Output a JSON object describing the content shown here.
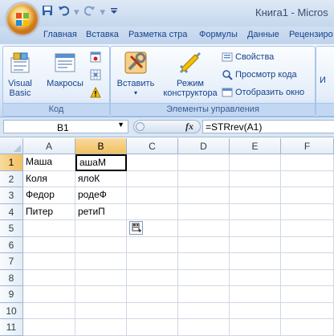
{
  "window": {
    "title": "Книга1 - Micros"
  },
  "quick_access": {
    "save_icon": "save-icon",
    "undo_icon": "undo-icon",
    "redo_icon": "redo-icon",
    "customize_icon": "chevron-down-icon"
  },
  "tabs": [
    {
      "label": "Главная"
    },
    {
      "label": "Вставка"
    },
    {
      "label": "Разметка стра"
    },
    {
      "label": "Формулы"
    },
    {
      "label": "Данные"
    },
    {
      "label": "Рецензиро"
    }
  ],
  "ribbon": {
    "code_group": {
      "label": "Код",
      "visual_basic": "Visual Basic",
      "visual_basic_line1": "Visual",
      "visual_basic_line2": "Basic",
      "macros": "Макросы"
    },
    "controls_group": {
      "label": "Элементы управления",
      "insert": "Вставить",
      "design_mode_line1": "Режим",
      "design_mode_line2": "конструктора",
      "properties": "Свойства",
      "view_code": "Просмотр кода",
      "show_window": "Отобразить окно"
    },
    "next_group": {
      "partial_label": "И"
    }
  },
  "formula_bar": {
    "name_box": "B1",
    "fx": "fx",
    "formula": "=STRrev(A1)"
  },
  "sheet": {
    "columns": [
      "A",
      "B",
      "C",
      "D",
      "E",
      "F"
    ],
    "rows": [
      "1",
      "2",
      "3",
      "4",
      "5",
      "6",
      "7",
      "8",
      "9",
      "10",
      "11"
    ],
    "selected_col": "B",
    "selected_row": "1",
    "cells": {
      "A1": "Маша",
      "B1": "ашаМ",
      "A2": "Коля",
      "B2": "ялоК",
      "A3": "Федор",
      "B3": "родеФ",
      "A4": "Питер",
      "B4": "ретиП"
    }
  },
  "colors": {
    "accent": "#15428b",
    "selection_header": "#f1c15f",
    "ribbon": "#dce8f7"
  }
}
